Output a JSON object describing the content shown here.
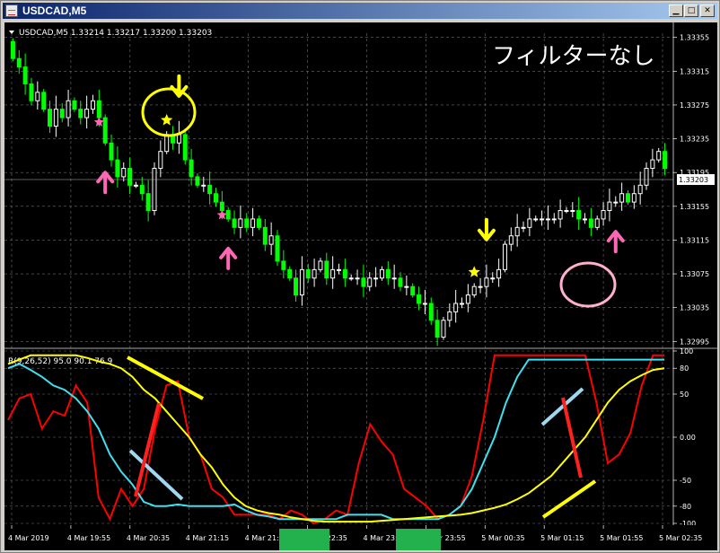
{
  "window": {
    "title": "USDCAD,M5"
  },
  "header": {
    "symbol_info": "USDCAD,M5  1.33214 1.33217 1.33200 1.33203",
    "annotation": "フィルターなし",
    "bid_label": "1.33203"
  },
  "colors": {
    "background": "#000000",
    "grid": "#6e6e6e",
    "candle_up": "#ffffff",
    "candle_down": "#00ff00",
    "line_red": "#ff0000",
    "line_cyan": "#40e0f0",
    "line_yellow": "#ffff00",
    "star_pink": "#ff66b3",
    "star_yellow": "#ffff00"
  },
  "icons": {
    "buy_arrow": "up-arrow-icon",
    "sell_arrow": "down-arrow-icon",
    "signal_star": "star-icon"
  },
  "chart_data": [
    {
      "type": "candlestick",
      "ylim": [
        1.3299,
        1.3336
      ],
      "yticks": [
        "1.33355",
        "1.33315",
        "1.33275",
        "1.33235",
        "1.33195",
        "1.33155",
        "1.33115",
        "1.33075",
        "1.33035",
        "1.32995"
      ],
      "xticks": [
        "4 Mar 2019",
        "4 Mar 19:55",
        "4 Mar 20:35",
        "4 Mar 21:15",
        "4 Mar 21:55",
        "4 Mar 22:35",
        "4 Mar 23:15",
        "4 Mar 23:55",
        "5 Mar 00:35",
        "5 Mar 01:15",
        "5 Mar 01:55",
        "5 Mar 02:35"
      ],
      "close_series": [
        1.3333,
        1.3332,
        1.333,
        1.3328,
        1.3329,
        1.3327,
        1.3325,
        1.3327,
        1.3326,
        1.3328,
        1.3327,
        1.3326,
        1.3327,
        1.3328,
        1.3326,
        1.3323,
        1.3321,
        1.3319,
        1.332,
        1.3318,
        1.3318,
        1.3317,
        1.3315,
        1.332,
        1.3322,
        1.3324,
        1.3323,
        1.3324,
        1.3321,
        1.3319,
        1.3318,
        1.3318,
        1.3317,
        1.3316,
        1.3315,
        1.3314,
        1.3313,
        1.3314,
        1.3313,
        1.3314,
        1.3313,
        1.3311,
        1.3312,
        1.3309,
        1.3308,
        1.3307,
        1.3305,
        1.3308,
        1.3307,
        1.3308,
        1.3309,
        1.3307,
        1.3308,
        1.3308,
        1.3307,
        1.3307,
        1.3307,
        1.3306,
        1.3307,
        1.3307,
        1.3308,
        1.3307,
        1.3307,
        1.3306,
        1.3306,
        1.3305,
        1.3304,
        1.3304,
        1.3302,
        1.33,
        1.3302,
        1.3303,
        1.3304,
        1.3304,
        1.3305,
        1.3306,
        1.3306,
        1.3307,
        1.3307,
        1.3308,
        1.3311,
        1.3312,
        1.3313,
        1.3313,
        1.3314,
        1.3314,
        1.3314,
        1.3314,
        1.3314,
        1.3315,
        1.3315,
        1.3315,
        1.3314,
        1.3314,
        1.3313,
        1.3314,
        1.3315,
        1.3316,
        1.3316,
        1.3317,
        1.3316,
        1.3317,
        1.3318,
        1.332,
        1.3321,
        1.3322,
        1.332
      ],
      "bid": 1.33203,
      "annotations": [
        {
          "kind": "buy_arrow",
          "bar": 15
        },
        {
          "kind": "buy_arrow",
          "bar": 35
        },
        {
          "kind": "buy_arrow",
          "bar": 98
        },
        {
          "kind": "sell_arrow",
          "bar": 27
        },
        {
          "kind": "sell_arrow",
          "bar": 77
        },
        {
          "kind": "pink_star",
          "bar": 14
        },
        {
          "kind": "pink_star",
          "bar": 34
        },
        {
          "kind": "yellow_star",
          "bar": 25
        },
        {
          "kind": "yellow_star",
          "bar": 75
        }
      ]
    },
    {
      "type": "line",
      "title": "R(9,26,52) 95.0 90.1 76.9",
      "ylim": [
        -100,
        100
      ],
      "yticks": [
        "100",
        "80",
        "50",
        "0.00",
        "-50",
        "-80",
        "-100"
      ],
      "series": [
        {
          "color": "#ff0000",
          "values": [
            20,
            45,
            50,
            10,
            30,
            25,
            60,
            40,
            -70,
            -95,
            -60,
            -80,
            -60,
            10,
            60,
            65,
            0,
            -20,
            -60,
            -70,
            -90,
            -90,
            -90,
            -90,
            -95,
            -85,
            -90,
            -100,
            -95,
            -85,
            -90,
            -30,
            15,
            -5,
            -20,
            -60,
            -70,
            -80,
            -95,
            -90,
            -80,
            -45,
            20,
            95,
            95,
            95,
            95,
            95,
            95,
            95,
            95,
            95,
            40,
            -30,
            -20,
            5,
            60,
            95,
            95
          ]
        },
        {
          "color": "#40e0f0",
          "values": [
            80,
            85,
            78,
            70,
            60,
            55,
            45,
            30,
            10,
            -20,
            -40,
            -55,
            -75,
            -80,
            -80,
            -78,
            -80,
            -80,
            -80,
            -80,
            -78,
            -85,
            -90,
            -92,
            -95,
            -95,
            -95,
            -95,
            -95,
            -95,
            -90,
            -90,
            -90,
            -90,
            -95,
            -95,
            -95,
            -95,
            -95,
            -90,
            -80,
            -60,
            -30,
            0,
            40,
            70,
            90,
            90,
            90,
            90,
            90,
            90,
            90,
            90,
            90,
            90,
            90,
            90,
            90
          ]
        },
        {
          "color": "#ffff00",
          "values": [
            85,
            90,
            95,
            95,
            95,
            95,
            95,
            92,
            88,
            85,
            80,
            70,
            55,
            45,
            30,
            15,
            0,
            -20,
            -35,
            -55,
            -70,
            -80,
            -85,
            -88,
            -90,
            -93,
            -95,
            -97,
            -98,
            -98,
            -98,
            -98,
            -98,
            -97,
            -96,
            -95,
            -94,
            -93,
            -92,
            -91,
            -90,
            -88,
            -85,
            -82,
            -78,
            -72,
            -65,
            -55,
            -45,
            -30,
            -15,
            0,
            20,
            40,
            55,
            65,
            72,
            78,
            80
          ]
        }
      ]
    }
  ]
}
